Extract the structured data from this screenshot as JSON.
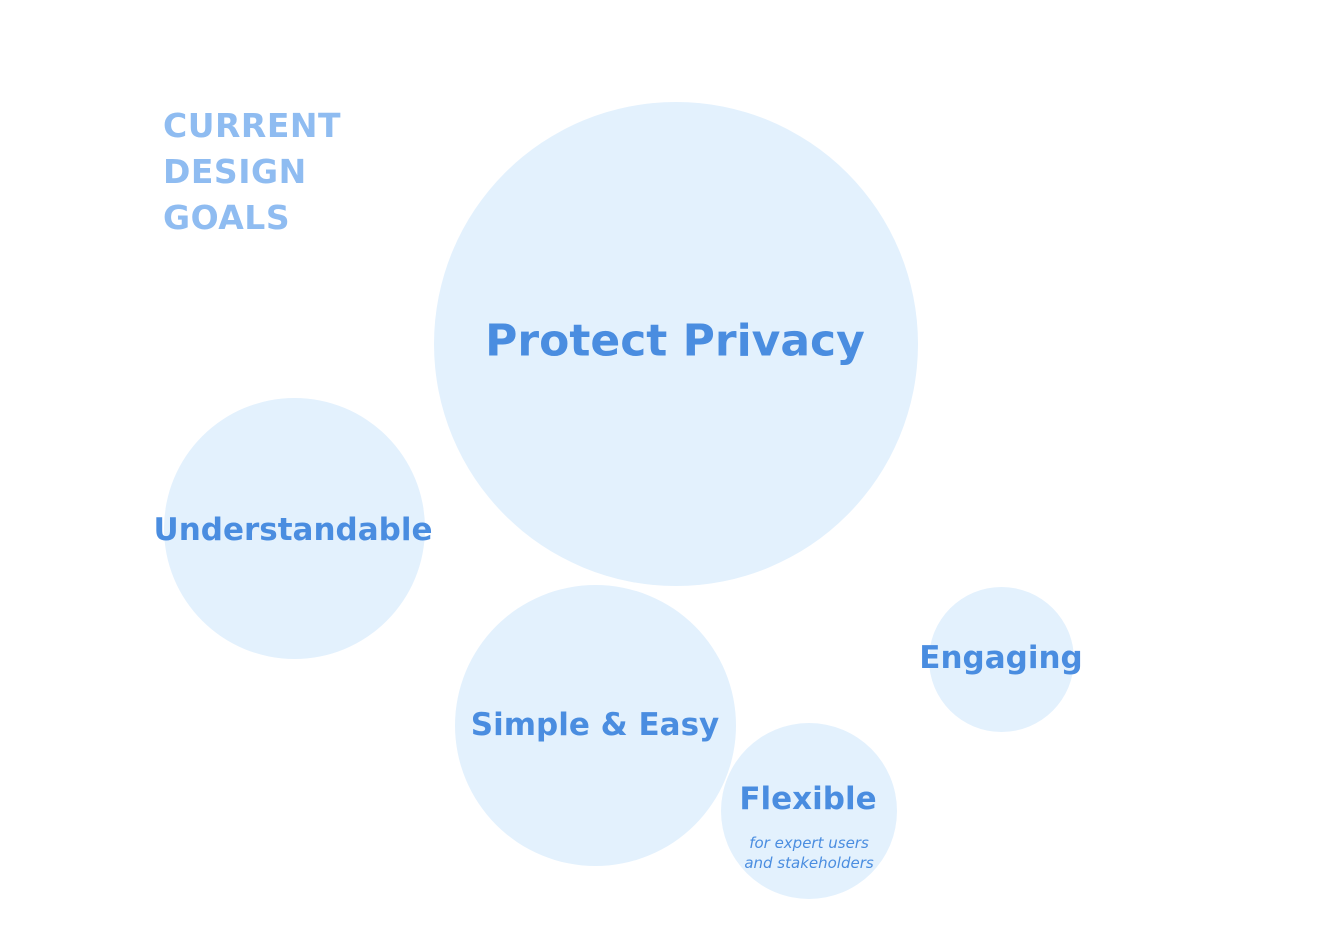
{
  "heading": "CURRENT\nDESIGN\nGOALS",
  "colors": {
    "bubble_fill": "#e3f1fd",
    "label_text": "#4a8de0",
    "heading_text": "#8fbcf1",
    "background": "#ffffff"
  },
  "goals": [
    {
      "id": "protect-privacy",
      "label": "Protect Privacy",
      "emphasis": "primary"
    },
    {
      "id": "understandable",
      "label": "Understandable"
    },
    {
      "id": "simple-easy",
      "label": "Simple & Easy"
    },
    {
      "id": "flexible",
      "label": "Flexible",
      "note": "for expert users\nand stakeholders"
    },
    {
      "id": "engaging",
      "label": "Engaging"
    }
  ]
}
